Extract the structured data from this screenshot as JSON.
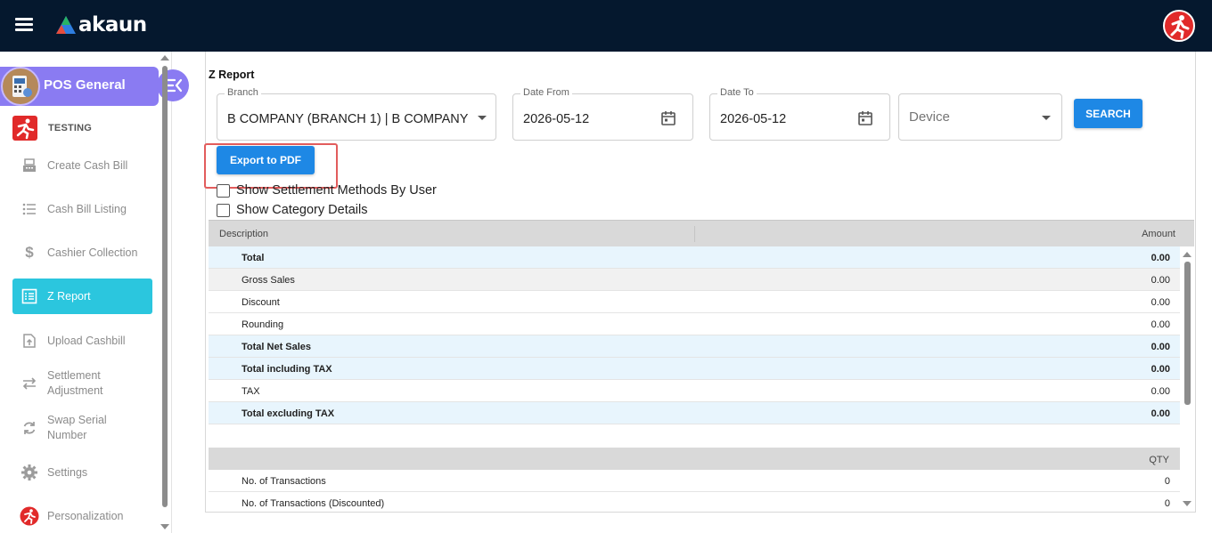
{
  "app": {
    "name": "akaun"
  },
  "sidebar": {
    "module_title": "POS General",
    "org_name": "TESTING",
    "items": [
      {
        "label": "Create Cash Bill",
        "icon": "cash-register-icon"
      },
      {
        "label": "Cash Bill Listing",
        "icon": "list-icon"
      },
      {
        "label": "Cashier Collection",
        "icon": "dollar-icon"
      },
      {
        "label": "Z Report",
        "icon": "report-icon",
        "active": true
      },
      {
        "label": "Upload Cashbill",
        "icon": "upload-icon"
      },
      {
        "label": "Settlement Adjustment",
        "icon": "swap-arrows-icon"
      },
      {
        "label": "Swap Serial Number",
        "icon": "sync-icon"
      },
      {
        "label": "Settings",
        "icon": "gear-icon"
      },
      {
        "label": "Personalization",
        "icon": "personalization-icon"
      }
    ]
  },
  "report": {
    "title": "Z Report",
    "branch": {
      "label": "Branch",
      "value": "B COMPANY (BRANCH 1) | B COMPANY ..."
    },
    "date_from": {
      "label": "Date From",
      "value": "2026-05-12"
    },
    "date_to": {
      "label": "Date To",
      "value": "2026-05-12"
    },
    "device": {
      "placeholder": "Device"
    },
    "search_label": "SEARCH",
    "export_label": "Export to PDF",
    "options": [
      {
        "label": "Show Settlement Methods By User",
        "checked": false
      },
      {
        "label": "Show Category Details",
        "checked": false
      }
    ]
  },
  "table": {
    "headers": {
      "description": "Description",
      "amount": "Amount"
    },
    "rows": [
      {
        "description": "Total",
        "amount": "0.00",
        "style": "bold blue"
      },
      {
        "description": "Gross Sales",
        "amount": "0.00",
        "style": "grey"
      },
      {
        "description": "Discount",
        "amount": "0.00",
        "style": ""
      },
      {
        "description": "Rounding",
        "amount": "0.00",
        "style": ""
      },
      {
        "description": "Total Net Sales",
        "amount": "0.00",
        "style": "bold blue"
      },
      {
        "description": "Total including TAX",
        "amount": "0.00",
        "style": "bold blue"
      },
      {
        "description": "TAX",
        "amount": "0.00",
        "style": ""
      },
      {
        "description": "Total excluding TAX",
        "amount": "0.00",
        "style": "bold blue"
      }
    ],
    "qty_header": "QTY",
    "qty_rows": [
      {
        "description": "No. of Transactions",
        "value": "0"
      },
      {
        "description": "No. of Transactions (Discounted)",
        "value": "0"
      }
    ]
  },
  "colors": {
    "topbar": "#05182e",
    "module_header": "#8a7bf2",
    "active_nav": "#2bc6de",
    "primary_button": "#1e88e5",
    "highlight": "#e25c5c"
  }
}
